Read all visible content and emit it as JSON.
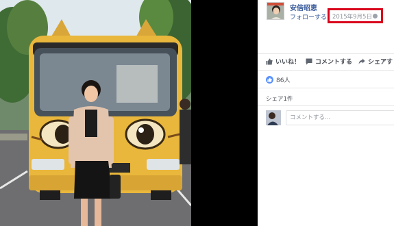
{
  "post": {
    "author_name": "安倍昭恵",
    "follow_label": "フォローする",
    "date": "2015年9月5日",
    "audience_icon": "globe-icon"
  },
  "actions": {
    "like_label": "いいね！",
    "comment_label": "コメントする",
    "share_label": "シェアす"
  },
  "stats": {
    "likes_count": "86人",
    "shares_text": "シェア1件"
  },
  "comment": {
    "placeholder": "コメントする..."
  },
  "colors": {
    "highlight_box": "#d9001b",
    "link_blue": "#365899",
    "like_blue": "#5890ff"
  }
}
